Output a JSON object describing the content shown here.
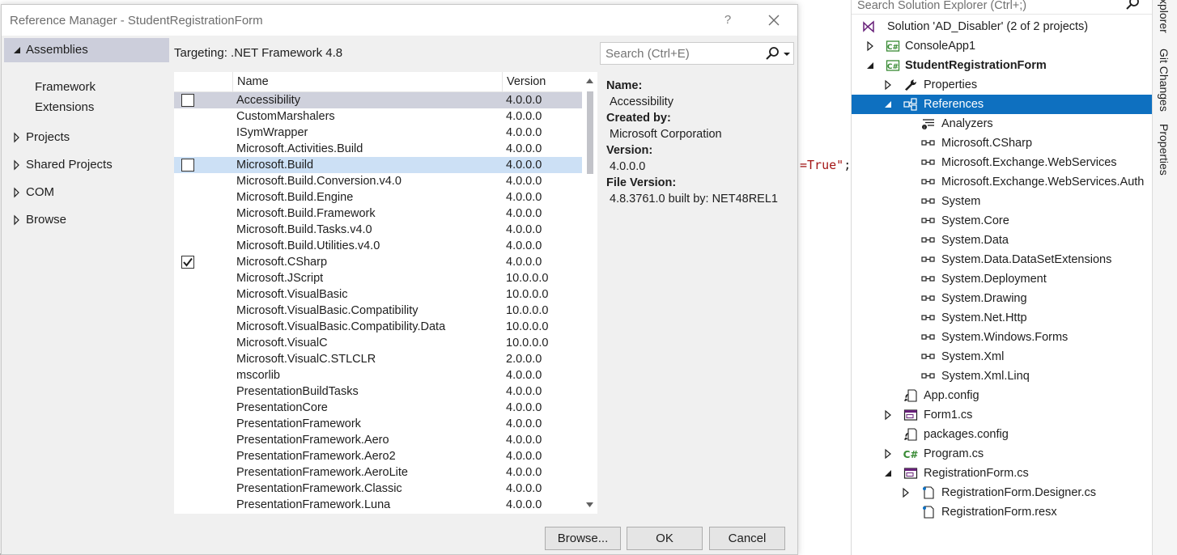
{
  "editor": {
    "code_fragment": "=True\"",
    "semicolon": ";"
  },
  "dialog": {
    "title": "Reference Manager - StudentRegistrationForm",
    "help_label": "?",
    "targeting": "Targeting: .NET Framework 4.8",
    "search_placeholder": "Search (Ctrl+E)",
    "nav": {
      "assemblies": "Assemblies",
      "framework": "Framework",
      "extensions": "Extensions",
      "projects": "Projects",
      "shared_projects": "Shared Projects",
      "com": "COM",
      "browse": "Browse"
    },
    "columns": {
      "name": "Name",
      "version": "Version"
    },
    "rows": [
      {
        "name": "Accessibility",
        "version": "4.0.0.0",
        "checkbox": "unchecked",
        "state": "hover"
      },
      {
        "name": "CustomMarshalers",
        "version": "4.0.0.0",
        "checkbox": "none",
        "state": ""
      },
      {
        "name": "ISymWrapper",
        "version": "4.0.0.0",
        "checkbox": "none",
        "state": ""
      },
      {
        "name": "Microsoft.Activities.Build",
        "version": "4.0.0.0",
        "checkbox": "none",
        "state": ""
      },
      {
        "name": "Microsoft.Build",
        "version": "4.0.0.0",
        "checkbox": "unchecked",
        "state": "selected"
      },
      {
        "name": "Microsoft.Build.Conversion.v4.0",
        "version": "4.0.0.0",
        "checkbox": "none",
        "state": ""
      },
      {
        "name": "Microsoft.Build.Engine",
        "version": "4.0.0.0",
        "checkbox": "none",
        "state": ""
      },
      {
        "name": "Microsoft.Build.Framework",
        "version": "4.0.0.0",
        "checkbox": "none",
        "state": ""
      },
      {
        "name": "Microsoft.Build.Tasks.v4.0",
        "version": "4.0.0.0",
        "checkbox": "none",
        "state": ""
      },
      {
        "name": "Microsoft.Build.Utilities.v4.0",
        "version": "4.0.0.0",
        "checkbox": "none",
        "state": ""
      },
      {
        "name": "Microsoft.CSharp",
        "version": "4.0.0.0",
        "checkbox": "checked",
        "state": ""
      },
      {
        "name": "Microsoft.JScript",
        "version": "10.0.0.0",
        "checkbox": "none",
        "state": ""
      },
      {
        "name": "Microsoft.VisualBasic",
        "version": "10.0.0.0",
        "checkbox": "none",
        "state": ""
      },
      {
        "name": "Microsoft.VisualBasic.Compatibility",
        "version": "10.0.0.0",
        "checkbox": "none",
        "state": ""
      },
      {
        "name": "Microsoft.VisualBasic.Compatibility.Data",
        "version": "10.0.0.0",
        "checkbox": "none",
        "state": ""
      },
      {
        "name": "Microsoft.VisualC",
        "version": "10.0.0.0",
        "checkbox": "none",
        "state": ""
      },
      {
        "name": "Microsoft.VisualC.STLCLR",
        "version": "2.0.0.0",
        "checkbox": "none",
        "state": ""
      },
      {
        "name": "mscorlib",
        "version": "4.0.0.0",
        "checkbox": "none",
        "state": ""
      },
      {
        "name": "PresentationBuildTasks",
        "version": "4.0.0.0",
        "checkbox": "none",
        "state": ""
      },
      {
        "name": "PresentationCore",
        "version": "4.0.0.0",
        "checkbox": "none",
        "state": ""
      },
      {
        "name": "PresentationFramework",
        "version": "4.0.0.0",
        "checkbox": "none",
        "state": ""
      },
      {
        "name": "PresentationFramework.Aero",
        "version": "4.0.0.0",
        "checkbox": "none",
        "state": ""
      },
      {
        "name": "PresentationFramework.Aero2",
        "version": "4.0.0.0",
        "checkbox": "none",
        "state": ""
      },
      {
        "name": "PresentationFramework.AeroLite",
        "version": "4.0.0.0",
        "checkbox": "none",
        "state": ""
      },
      {
        "name": "PresentationFramework.Classic",
        "version": "4.0.0.0",
        "checkbox": "none",
        "state": ""
      },
      {
        "name": "PresentationFramework.Luna",
        "version": "4.0.0.0",
        "checkbox": "none",
        "state": ""
      }
    ],
    "details": {
      "name_label": "Name:",
      "name_value": "Accessibility",
      "created_label": "Created by:",
      "created_value": "Microsoft Corporation",
      "version_label": "Version:",
      "version_value": "4.0.0.0",
      "file_version_label": "File Version:",
      "file_version_value": "4.8.3761.0 built by: NET48REL1"
    },
    "buttons": {
      "browse": "Browse...",
      "ok": "OK",
      "cancel": "Cancel"
    }
  },
  "solution_explorer": {
    "search_placeholder": "Search Solution Explorer (Ctrl+;)",
    "items": [
      {
        "label": "Solution 'AD_Disabler' (2 of 2 projects)",
        "icon": "solution-icon",
        "expander": "none",
        "level": 0,
        "bold": false,
        "selected": false
      },
      {
        "label": "ConsoleApp1",
        "icon": "csharp-project-icon",
        "expander": "collapsed",
        "level": 1,
        "bold": false,
        "selected": false
      },
      {
        "label": "StudentRegistrationForm",
        "icon": "csharp-project-icon",
        "expander": "expanded",
        "level": 1,
        "bold": true,
        "selected": false
      },
      {
        "label": "Properties",
        "icon": "wrench-icon",
        "expander": "collapsed",
        "level": 2,
        "bold": false,
        "selected": false
      },
      {
        "label": "References",
        "icon": "references-icon",
        "expander": "expanded",
        "level": 2,
        "bold": false,
        "selected": true
      },
      {
        "label": "Analyzers",
        "icon": "analyzers-icon",
        "expander": "none",
        "level": 3,
        "bold": false,
        "selected": false
      },
      {
        "label": "Microsoft.CSharp",
        "icon": "reference-icon",
        "expander": "none",
        "level": 3,
        "bold": false,
        "selected": false
      },
      {
        "label": "Microsoft.Exchange.WebServices",
        "icon": "reference-icon",
        "expander": "none",
        "level": 3,
        "bold": false,
        "selected": false
      },
      {
        "label": "Microsoft.Exchange.WebServices.Auth",
        "icon": "reference-icon",
        "expander": "none",
        "level": 3,
        "bold": false,
        "selected": false
      },
      {
        "label": "System",
        "icon": "reference-icon",
        "expander": "none",
        "level": 3,
        "bold": false,
        "selected": false
      },
      {
        "label": "System.Core",
        "icon": "reference-icon",
        "expander": "none",
        "level": 3,
        "bold": false,
        "selected": false
      },
      {
        "label": "System.Data",
        "icon": "reference-icon",
        "expander": "none",
        "level": 3,
        "bold": false,
        "selected": false
      },
      {
        "label": "System.Data.DataSetExtensions",
        "icon": "reference-icon",
        "expander": "none",
        "level": 3,
        "bold": false,
        "selected": false
      },
      {
        "label": "System.Deployment",
        "icon": "reference-icon",
        "expander": "none",
        "level": 3,
        "bold": false,
        "selected": false
      },
      {
        "label": "System.Drawing",
        "icon": "reference-icon",
        "expander": "none",
        "level": 3,
        "bold": false,
        "selected": false
      },
      {
        "label": "System.Net.Http",
        "icon": "reference-icon",
        "expander": "none",
        "level": 3,
        "bold": false,
        "selected": false
      },
      {
        "label": "System.Windows.Forms",
        "icon": "reference-icon",
        "expander": "none",
        "level": 3,
        "bold": false,
        "selected": false
      },
      {
        "label": "System.Xml",
        "icon": "reference-icon",
        "expander": "none",
        "level": 3,
        "bold": false,
        "selected": false
      },
      {
        "label": "System.Xml.Linq",
        "icon": "reference-icon",
        "expander": "none",
        "level": 3,
        "bold": false,
        "selected": false
      },
      {
        "label": "App.config",
        "icon": "config-file-icon",
        "expander": "none",
        "level": 2,
        "bold": false,
        "selected": false
      },
      {
        "label": "Form1.cs",
        "icon": "form-icon",
        "expander": "collapsed",
        "level": 2,
        "bold": false,
        "selected": false
      },
      {
        "label": "packages.config",
        "icon": "config-file-icon",
        "expander": "none",
        "level": 2,
        "bold": false,
        "selected": false
      },
      {
        "label": "Program.cs",
        "icon": "csharp-file-icon",
        "expander": "collapsed",
        "level": 2,
        "bold": false,
        "selected": false
      },
      {
        "label": "RegistrationForm.cs",
        "icon": "form-icon",
        "expander": "expanded",
        "level": 2,
        "bold": false,
        "selected": false
      },
      {
        "label": "RegistrationForm.Designer.cs",
        "icon": "designer-file-icon",
        "expander": "collapsed",
        "level": 3,
        "bold": false,
        "selected": false
      },
      {
        "label": "RegistrationForm.resx",
        "icon": "resx-file-icon",
        "expander": "none",
        "level": 3,
        "bold": false,
        "selected": false
      }
    ]
  },
  "side_tabs": {
    "explorer": "xplorer",
    "git_changes": "Git Changes",
    "properties": "Properties"
  },
  "colors": {
    "selection_blue": "#0e70c0",
    "nav_selected": "#cccedb",
    "row_selected": "#cce0f5",
    "row_hover": "#cfd1dc",
    "code_string": "#a31515",
    "csharp_green": "#388a34",
    "vs_purple": "#68217a"
  }
}
